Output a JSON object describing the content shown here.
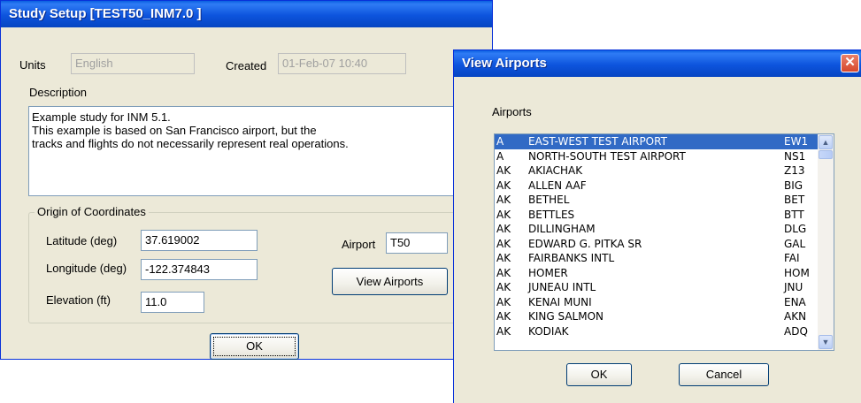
{
  "study_setup": {
    "title": "Study Setup [TEST50_INM7.0 ]",
    "units_label": "Units",
    "units_value": "English",
    "created_label": "Created",
    "created_value": "01-Feb-07 10:40",
    "description_label": "Description",
    "description_lines": [
      "Example study for INM 5.1.",
      "This example is based on San Francisco airport, but the",
      "tracks and flights do not necessarily represent real operations."
    ],
    "origin_group_label": "Origin of Coordinates",
    "latitude_label": "Latitude (deg)",
    "latitude_value": "37.619002",
    "longitude_label": "Longitude (deg)",
    "longitude_value": "-122.374843",
    "elevation_label": "Elevation (ft)",
    "elevation_value": "11.0",
    "airport_label": "Airport",
    "airport_value": "T50",
    "view_airports_button": "View Airports",
    "ok_button": "OK"
  },
  "view_airports": {
    "title": "View Airports",
    "close_glyph": "✕",
    "airports_label": "Airports",
    "airports": [
      {
        "state": "A",
        "name": "EAST-WEST TEST AIRPORT",
        "code": "EW1",
        "selected": true
      },
      {
        "state": "A",
        "name": "NORTH-SOUTH TEST AIRPORT",
        "code": "NS1"
      },
      {
        "state": "AK",
        "name": "AKIACHAK",
        "code": "Z13"
      },
      {
        "state": "AK",
        "name": "ALLEN AAF",
        "code": "BIG"
      },
      {
        "state": "AK",
        "name": "BETHEL",
        "code": "BET"
      },
      {
        "state": "AK",
        "name": "BETTLES",
        "code": "BTT"
      },
      {
        "state": "AK",
        "name": "DILLINGHAM",
        "code": "DLG"
      },
      {
        "state": "AK",
        "name": "EDWARD G. PITKA SR",
        "code": "GAL"
      },
      {
        "state": "AK",
        "name": "FAIRBANKS INTL",
        "code": "FAI"
      },
      {
        "state": "AK",
        "name": "HOMER",
        "code": "HOM"
      },
      {
        "state": "AK",
        "name": "JUNEAU INTL",
        "code": "JNU"
      },
      {
        "state": "AK",
        "name": "KENAI MUNI",
        "code": "ENA"
      },
      {
        "state": "AK",
        "name": "KING SALMON",
        "code": "AKN"
      },
      {
        "state": "AK",
        "name": "KODIAK",
        "code": "ADQ"
      }
    ],
    "scroll_up_icon": "▲",
    "scroll_down_icon": "▼",
    "ok_button": "OK",
    "cancel_button": "Cancel"
  }
}
